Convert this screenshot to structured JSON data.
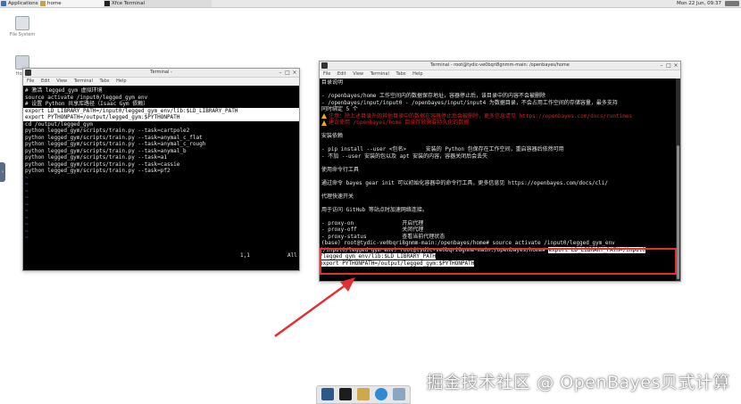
{
  "panel": {
    "applications_label": "Applications",
    "home_task_label": "home",
    "terminal_task_label": "Xfce Terminal",
    "clock": "Mon 22 Jun, 09:37"
  },
  "desktop": {
    "filesystem_label": "File System",
    "home_label": "Home"
  },
  "left_terminal": {
    "title": "Terminal -",
    "menu": [
      "File",
      "Edit",
      "View",
      "Terminal",
      "Tabs",
      "Help"
    ],
    "lines": [
      "# 激活 legged_gym 虚拟环境",
      "source activate /input0/legged_gym_env",
      "# 设置 Python 共享库路径（Isaac Gym 依赖）",
      "export LD_LIBRARY_PATH=/input0/legged_gym_env/lib:$LD_LIBRARY_PATH",
      "export PYTHONPATH=/output/legged_gym:$PYTHONPATH",
      "cd /output/legged_gym",
      "python legged_gym/scripts/train.py --task=cartpole2",
      "python legged_gym/scripts/train.py --task=anymal_c_flat",
      "python legged_gym/scripts/train.py --task=anymal_c_rough",
      "python legged_gym/scripts/train.py --task=anymal_b",
      "python legged_gym/scripts/train.py --task=a1",
      "python legged_gym/scripts/train.py --task=cassie",
      "python legged_gym/scripts/train.py --task=pf2"
    ],
    "tilde": "~",
    "status_position": "1,1",
    "status_all": "All"
  },
  "right_terminal": {
    "title": "Terminal - root@tydic-ve0bqri8gnmm-main: /openbayes/home",
    "menu": [
      "File",
      "Edit",
      "View",
      "Terminal",
      "Tabs",
      "Help"
    ],
    "lines": [
      {
        "t": "目录说明",
        "c": ""
      },
      {
        "t": "",
        "c": ""
      },
      {
        "t": "- /openbayes/home 工作空间内的数据保存地址，容器停止后，该目录中的内容不会被删除",
        "c": ""
      },
      {
        "t": "- /openbayes/input/input0 - /openbayes/input/input4 为数据目录，不会占用工作空间的存储容量，最多支持",
        "c": ""
      },
      {
        "t": "同时绑定 5 个",
        "c": ""
      },
      {
        "t": "注意：除上述目录外的其他目录中的数据在容器停止后会被删除，更多信息请见 https://openbayes.com/docs/runtimes",
        "c": "warn"
      },
      {
        "t": "建议使用 /openbayes/home 目录存放需要持久化的数据",
        "c": "warn"
      },
      {
        "t": "",
        "c": ""
      },
      {
        "t": "安装依赖",
        "c": ""
      },
      {
        "t": "",
        "c": ""
      },
      {
        "t": "- pip install --user <包名>      安装的 Python 包保存在工作空间，重启容器后依然可用",
        "c": ""
      },
      {
        "t": "- 不加 --user 安装的包以及 apt 安装的内容，容器关闭后会丢失",
        "c": ""
      },
      {
        "t": "",
        "c": ""
      },
      {
        "t": "使用命令行工具",
        "c": ""
      },
      {
        "t": "",
        "c": ""
      },
      {
        "t": "通过命令 bayes gear init 可以初始化容器中的命令行工具，更多信息见 https://openbayes.com/docs/cli/",
        "c": ""
      },
      {
        "t": "",
        "c": ""
      },
      {
        "t": "代理快速开关",
        "c": ""
      },
      {
        "t": "",
        "c": ""
      },
      {
        "t": "用于访问 GitHub 等站点时加速网络连接。",
        "c": ""
      },
      {
        "t": "",
        "c": ""
      },
      {
        "t": "- proxy-on               开启代理",
        "c": ""
      },
      {
        "t": "- proxy-off              关闭代理",
        "c": ""
      },
      {
        "t": "- proxy-status           查看当前代理状态",
        "c": ""
      },
      {
        "t": "(base) root@tydic-ve0bqri8gnmm-main:/openbayes/home# source activate /input0/legged_gym_env",
        "c": ""
      }
    ],
    "highlight": {
      "prompt": "(/input0/legged_gym_env) root@tydic-ve0bqri8gnmm-main:/openbayes/home# ",
      "cmd1_part1": "export LD_LIBRARY_PATH=/input0",
      "cmd1_part2": "/legged_gym_env/lib:$LD_LIBRARY_PATH",
      "cmd2": "export PYTHONPATH=/output/legged_gym:$PYTHONPATH"
    }
  },
  "watermark": "掘金技术社区 @ OpenBayes贝式计算",
  "colors": {
    "highlight_box": "#e03030",
    "terminal_bg": "#000000",
    "warning_text": "#d02020"
  },
  "icons": [
    "applications-icon",
    "folder-icon",
    "terminal-icon",
    "filesystem-icon",
    "home-folder-icon",
    "web-browser-icon",
    "search-icon"
  ]
}
